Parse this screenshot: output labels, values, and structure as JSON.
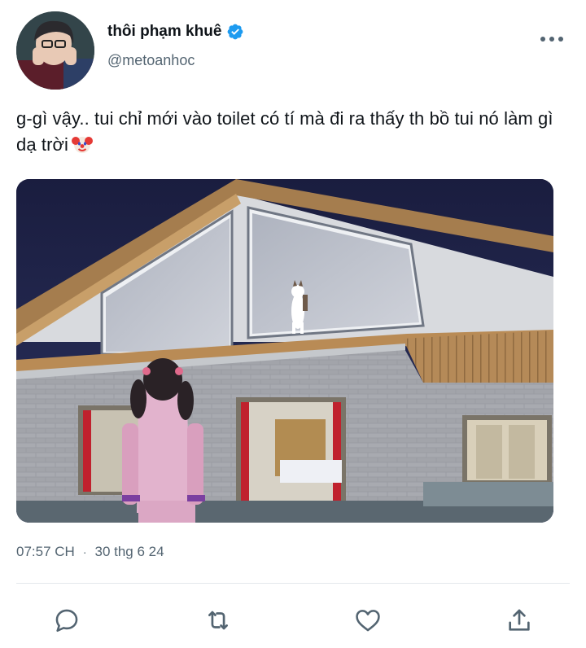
{
  "tweet": {
    "display_name": "thôi phạm khuê",
    "handle": "@metoanhoc",
    "text": "g-gì vậy.. tui chỉ mới vào toilet có tí mà đi ra thấy th bồ tui nó làm gì dạ trời",
    "time": "07:57 CH",
    "separator": "·",
    "date": "30 thg 6 24",
    "verified": true
  },
  "icons": {
    "verified": "verified-badge-icon",
    "more": "more-options-icon",
    "emoji": "clown-face-emoji",
    "reply": "reply-icon",
    "retweet": "retweet-icon",
    "like": "heart-icon",
    "share": "share-icon"
  },
  "colors": {
    "accent": "#1d9bf0",
    "secondary_text": "#536471",
    "icon": "#536471"
  }
}
